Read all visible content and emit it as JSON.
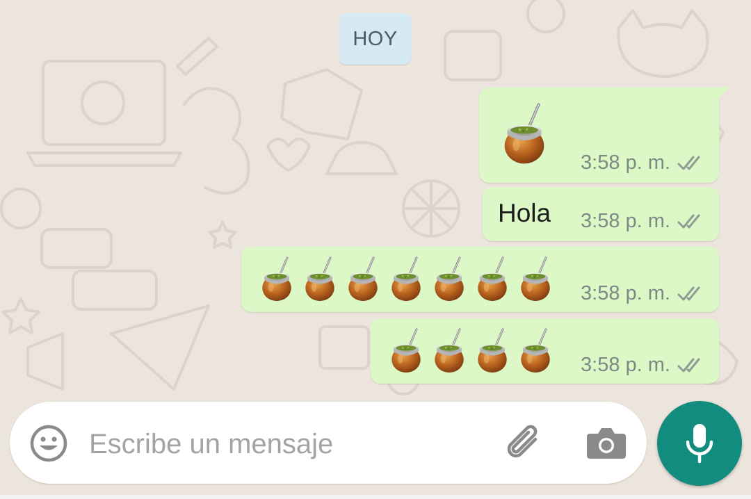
{
  "chat": {
    "date_label": "HOY",
    "messages": [
      {
        "type": "emoji",
        "emoji_count": 1,
        "time": "3:58 p. m.",
        "status": "read-ticks"
      },
      {
        "type": "text",
        "text": "Hola",
        "time": "3:58 p. m.",
        "status": "read-ticks"
      },
      {
        "type": "emoji",
        "emoji_count": 7,
        "time": "3:58 p. m.",
        "status": "read-ticks"
      },
      {
        "type": "emoji",
        "emoji_count": 4,
        "time": "3:58 p. m.",
        "status": "read-ticks"
      }
    ]
  },
  "composer": {
    "placeholder": "Escribe un mensaje",
    "value": "",
    "emoji_button_icon": "emoji-smiley-icon",
    "attach_button_icon": "paperclip-icon",
    "camera_button_icon": "camera-icon",
    "send_button_icon": "microphone-icon"
  },
  "colors": {
    "wallpaper": "#ECE5DD",
    "outgoing_bubble": "#DCF8C6",
    "date_chip": "#D5EAF3",
    "accent_fab": "#128C7E",
    "timestamp": "#7C8A83"
  }
}
